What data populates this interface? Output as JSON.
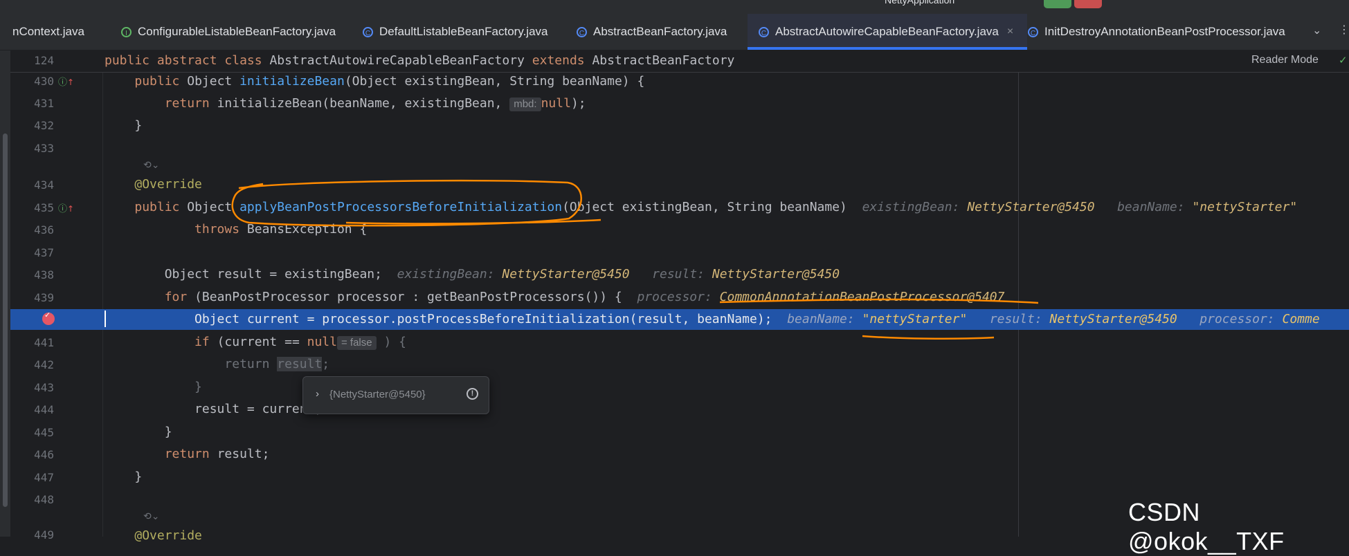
{
  "app": {
    "run_config": "NettyApplication",
    "reader_mode": "Reader Mode",
    "colors": {
      "bg": "#1e1f22",
      "selection": "#2154a8",
      "keyword": "#cf8e6d",
      "method": "#56a8f5",
      "annotation": "#b3ae60",
      "string": "#6aab73",
      "markup": "#ff8a00"
    }
  },
  "tabs": [
    {
      "label": "nContext.java",
      "icon": "class-icon",
      "active": false
    },
    {
      "label": "ConfigurableListableBeanFactory.java",
      "icon": "interface-icon",
      "active": false
    },
    {
      "label": "DefaultListableBeanFactory.java",
      "icon": "class-icon",
      "active": false
    },
    {
      "label": "AbstractBeanFactory.java",
      "icon": "class-icon",
      "active": false
    },
    {
      "label": "AbstractAutowireCapableBeanFactory.java",
      "icon": "class-icon",
      "active": true,
      "close": "×"
    },
    {
      "label": "InitDestroyAnnotationBeanPostProcessor.java",
      "icon": "class-icon",
      "active": false
    }
  ],
  "editor": {
    "sticky": {
      "line": "124",
      "kw1": "public",
      "kw2": "abstract",
      "kw3": "class",
      "name": "AbstractAutowireCapableBeanFactory",
      "kw4": "extends",
      "parent": "AbstractBeanFactory"
    },
    "lines": {
      "n430": "430",
      "n431": "431",
      "n432": "432",
      "n433": "433",
      "n434": "434",
      "n435": "435",
      "n436": "436",
      "n437": "437",
      "n438": "438",
      "n439": "439",
      "n441": "441",
      "n442": "442",
      "n443": "443",
      "n444": "444",
      "n445": "445",
      "n446": "446",
      "n447": "447",
      "n448": "448",
      "n449": "449"
    },
    "code": {
      "l430_a": "public",
      "l430_b": " Object ",
      "l430_fn": "initializeBean",
      "l430_c": "(Object existingBean, String beanName) {",
      "l431_kw": "return",
      "l431_a": " initializeBean(beanName, existingBean, ",
      "l431_hint": "mbd:",
      "l431_null": "null",
      "l431_end": ");",
      "l432": "}",
      "l434": "@Override",
      "l435_kw": "public",
      "l435_a": " Object ",
      "l435_fn": "applyBeanPostProcessorsBeforeInitialization",
      "l435_b": "(Object existingBean, String beanName)",
      "l435_h1": "existingBean:",
      "l435_v1": "NettyStarter@5450",
      "l435_h2": "beanName:",
      "l435_v2": "\"nettyStarter\"",
      "l436_kw": "throws",
      "l436_a": " BeansException {",
      "l438_a": "Object result = existingBean;",
      "l438_h1": "existingBean:",
      "l438_v1": "NettyStarter@5450",
      "l438_h2": "result:",
      "l438_v2": "NettyStarter@5450",
      "l439_kw": "for",
      "l439_a": " (BeanPostProcessor processor : getBeanPostProcessors()) {",
      "l439_h": "processor:",
      "l439_v": "CommonAnnotationBeanPostProcessor@5407",
      "l440_a": "Object current = processor.postProcessBeforeInitialization(result, beanName);",
      "l440_h1": "beanName:",
      "l440_v1": "\"nettyStarter\"",
      "l440_h2": "result:",
      "l440_v2": "NettyStarter@5450",
      "l440_h3": "processor:",
      "l440_v3": "Comme",
      "l441_kw": "if",
      "l441_a": " (current == ",
      "l441_null": "null",
      "l441_pill": "= false",
      "l441_end": " ) {",
      "l442_kw": "return",
      "l442_a": "result",
      "l442_end": ";",
      "l443": "}",
      "l444": "result = current;",
      "l445": "}",
      "l446_kw": "return",
      "l446_a": " result;",
      "l447": "}",
      "l449": "@Override"
    },
    "popup": {
      "value": "{NettyStarter@5450}"
    }
  },
  "watermark": "CSDN @okok__TXF"
}
